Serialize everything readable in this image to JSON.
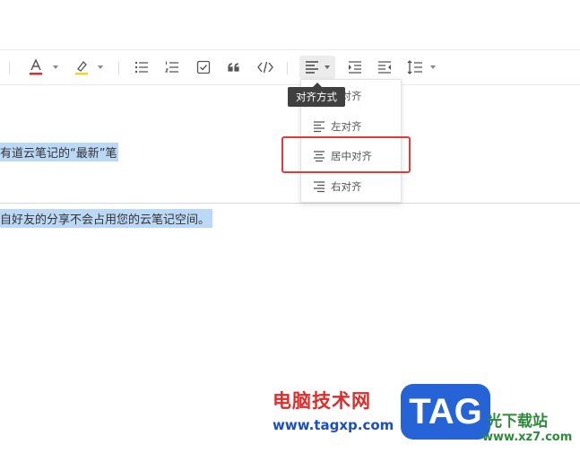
{
  "toolbar": {
    "icons": [
      "font-color-icon",
      "highlight-icon",
      "bullet-list-icon",
      "numbered-list-icon",
      "checkbox-icon",
      "quote-icon",
      "code-icon",
      "align-icon",
      "indent-increase-icon",
      "indent-decrease-icon",
      "line-height-icon"
    ],
    "font_color": "#e02b2b",
    "highlight_color": "#f5d327"
  },
  "tooltip": {
    "label": "对齐方式"
  },
  "align_menu": {
    "items": [
      {
        "label": "端对齐",
        "icon": "justify-icon"
      },
      {
        "label": "左对齐",
        "icon": "align-left-icon"
      },
      {
        "label": "居中对齐",
        "icon": "align-center-icon"
      },
      {
        "label": "右对齐",
        "icon": "align-right-icon"
      }
    ],
    "highlight_color": "#e03a3a"
  },
  "document": {
    "line1": "有道云笔记的“最新”笔",
    "line2": "自好友的分享不会占用您的云笔记空间。",
    "selection_color": "#bcd8f7"
  },
  "watermarks": {
    "site1_name": "电脑技术网",
    "site1_url": "www.tagxp.com",
    "badge": "TAG",
    "site2_name": "光下载站",
    "site2_url": "www.xz7.com"
  }
}
